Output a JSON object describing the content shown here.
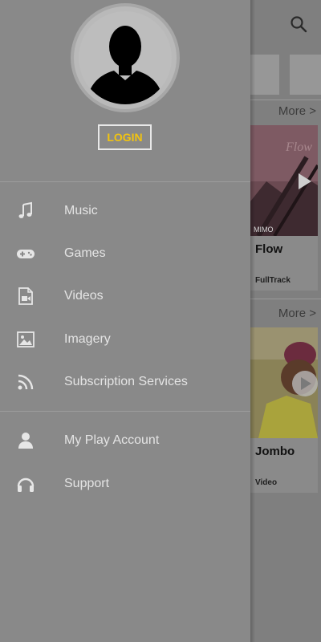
{
  "drawer": {
    "login_label": "LOGIN",
    "sections": [
      {
        "items": [
          {
            "label": "Music",
            "icon": "music-note-icon"
          },
          {
            "label": "Games",
            "icon": "gamepad-icon"
          },
          {
            "label": "Videos",
            "icon": "video-file-icon"
          },
          {
            "label": "Imagery",
            "icon": "image-icon"
          },
          {
            "label": "Subscription Services",
            "icon": "rss-icon"
          }
        ]
      },
      {
        "items": [
          {
            "label": "My Play Account",
            "icon": "person-icon"
          },
          {
            "label": "Support",
            "icon": "headset-icon"
          }
        ]
      }
    ]
  },
  "background": {
    "more_label_1": "More >",
    "more_label_2": "More >",
    "card_1": {
      "title": "Flow",
      "subtitle": "FullTrack",
      "thumb_caption": "MIMO"
    },
    "card_2": {
      "title": "Jombo",
      "subtitle": "Video"
    }
  },
  "colors": {
    "login_accent": "#f2c40f",
    "drawer_bg": "#898989",
    "menu_text": "#e4e4e4"
  }
}
